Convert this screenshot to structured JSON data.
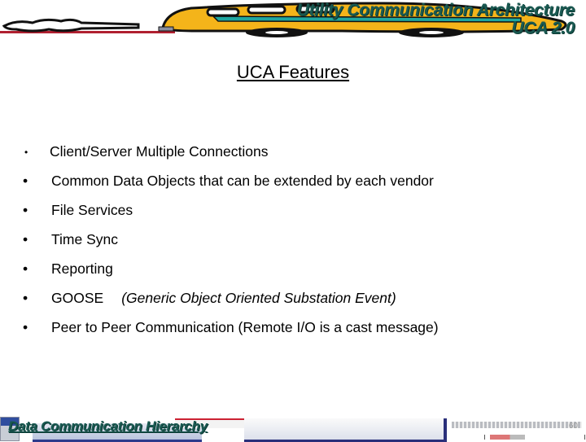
{
  "header": {
    "title_line1": "Utility Communication Architecture",
    "title_line2": "UCA 2.0",
    "title_color": "#1a5a52"
  },
  "slide": {
    "title": "UCA Features",
    "bullet_glyph": "•",
    "bullets": [
      {
        "text": "Client/Server Multiple Connections"
      },
      {
        "text": "Common Data Objects that can be extended by each vendor"
      },
      {
        "text": "File Services"
      },
      {
        "text": "Time Sync"
      },
      {
        "text": "Reporting"
      },
      {
        "text": "GOOSE",
        "note": "(Generic Object Oriented Substation Event)"
      },
      {
        "text": "Peer to Peer Communication (Remote I/O is a cast message)"
      }
    ]
  },
  "footer": {
    "title": "Data Communication Hierarchy",
    "page_number": "60"
  },
  "colors": {
    "bus_yellow": "#f4b41a",
    "bus_teal": "#1fa6a0",
    "road_red": "#b02030"
  }
}
